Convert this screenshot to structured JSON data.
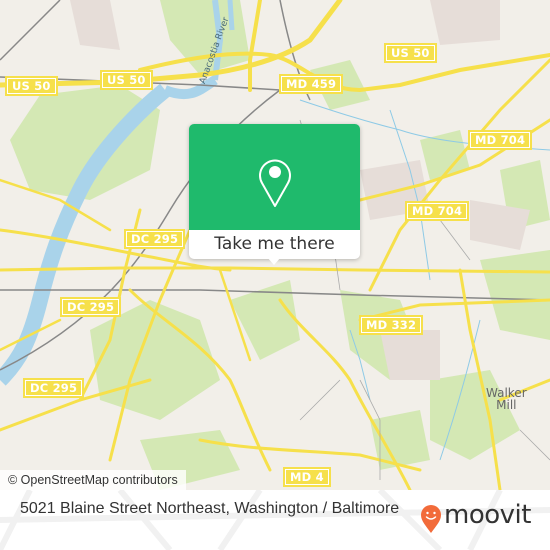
{
  "map": {
    "road_labels": [
      {
        "text": "US 50",
        "id": "us-50-west"
      },
      {
        "text": "US 50",
        "id": "us-50-center"
      },
      {
        "text": "US 50",
        "id": "us-50-east"
      },
      {
        "text": "MD 459",
        "id": "md-459"
      },
      {
        "text": "MD 704",
        "id": "md-704-north"
      },
      {
        "text": "MD 704",
        "id": "md-704-south"
      },
      {
        "text": "DC 295",
        "id": "dc-295-north"
      },
      {
        "text": "DC 295",
        "id": "dc-295-center"
      },
      {
        "text": "DC 295",
        "id": "dc-295-south"
      },
      {
        "text": "MD 332",
        "id": "md-332"
      },
      {
        "text": "MD 4",
        "id": "md-4"
      }
    ],
    "place_labels": [
      {
        "text": "Walker\nMill"
      }
    ],
    "water_labels": [
      {
        "text": "Anacostia River"
      }
    ],
    "attribution": "© OpenStreetMap contributors",
    "colors": {
      "land": "#f2efe9",
      "park": "#d4e8b4",
      "water": "#a9d3ea",
      "road": "#f6e04b",
      "rail": "#888888"
    }
  },
  "popup": {
    "icon": "map-pin-icon",
    "button_label": "Take me there",
    "color": "#1fba6c"
  },
  "footer": {
    "address": "5021 Blaine Street Northeast, Washington / Baltimore",
    "brand": "moovit",
    "brand_icon": "moovit-smiley-pin-icon",
    "brand_color": "#f26b3a"
  }
}
